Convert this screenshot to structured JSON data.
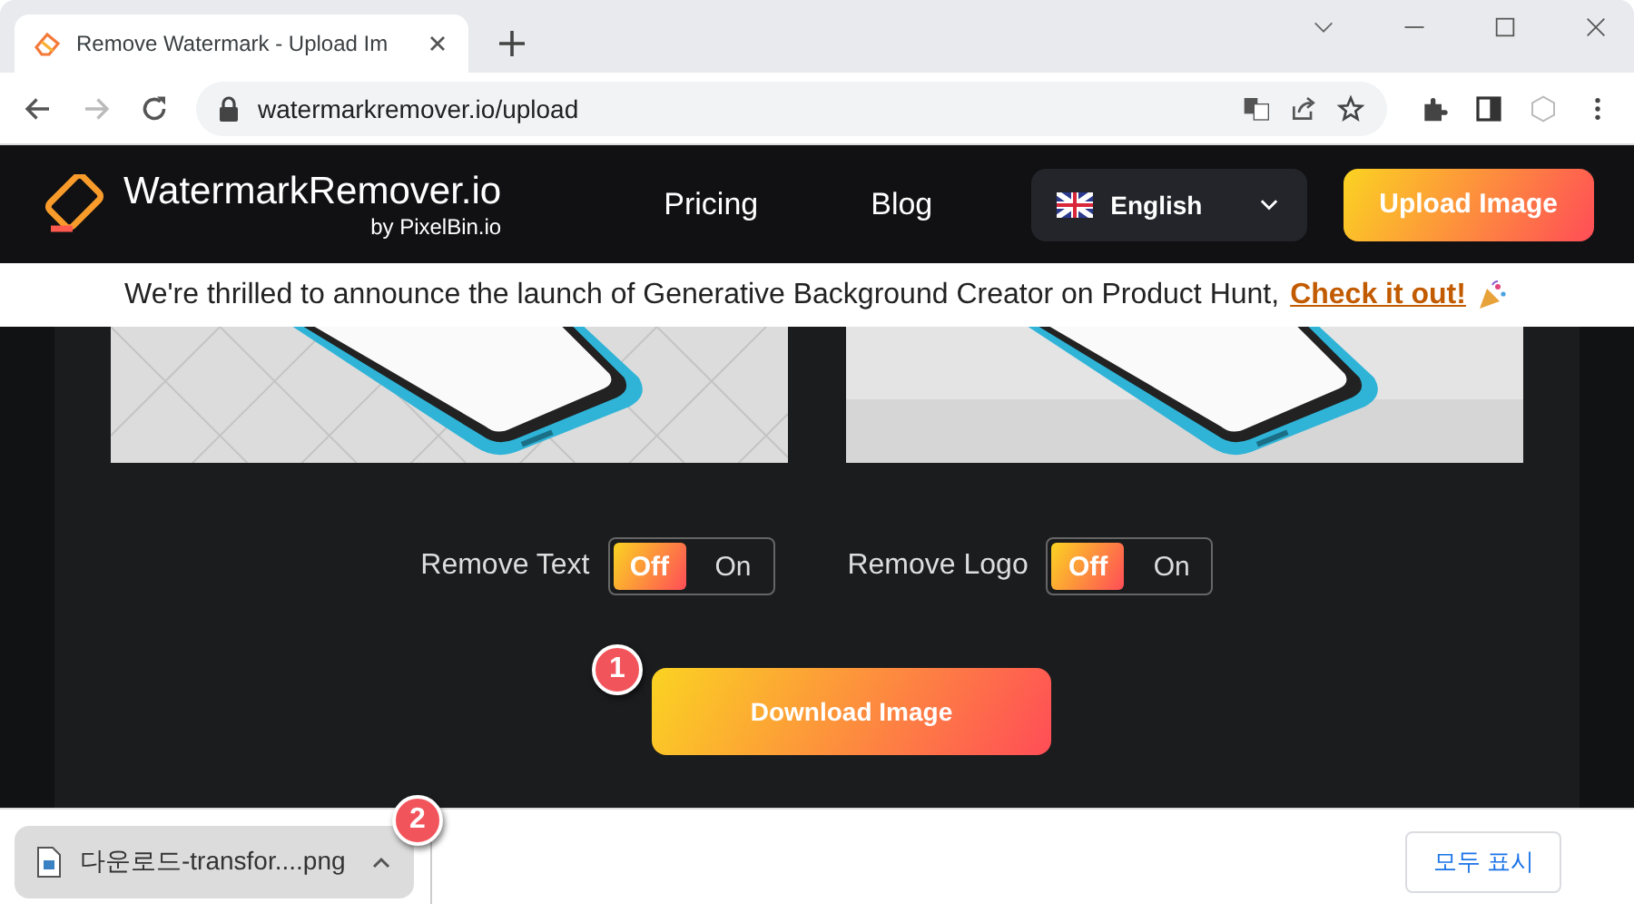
{
  "browser": {
    "tab": {
      "title": "Remove Watermark - Upload Im"
    },
    "address": "watermarkremover.io/upload"
  },
  "site": {
    "logo": "WatermarkRemover.io",
    "logo_sub": "by PixelBin.io",
    "nav": [
      "Pricing",
      "Blog"
    ],
    "language": "English",
    "upload_button": "Upload Image"
  },
  "announcement": {
    "text": "We're thrilled to announce the launch of Generative Background Creator on Product Hunt,",
    "link": "Check it out!"
  },
  "toggles": [
    {
      "label": "Remove Text",
      "options": [
        {
          "label": "Off",
          "selected": true
        },
        {
          "label": "On",
          "selected": false
        }
      ]
    },
    {
      "label": "Remove Logo",
      "options": [
        {
          "label": "Off",
          "selected": true
        },
        {
          "label": "On",
          "selected": false
        }
      ]
    }
  ],
  "download_button": "Download Image",
  "callouts": [
    "1",
    "2"
  ],
  "download_bar": {
    "file": "다운로드-transfor....png",
    "show_all": "모두 표시"
  }
}
